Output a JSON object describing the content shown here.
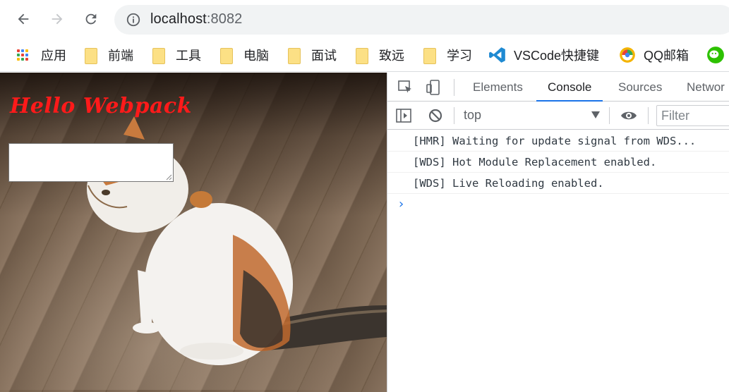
{
  "browser": {
    "url_host": "localhost",
    "url_port": ":8082"
  },
  "bookmarks": [
    {
      "label": "应用",
      "icon": "apps-icon"
    },
    {
      "label": "前端",
      "icon": "folder-icon"
    },
    {
      "label": "工具",
      "icon": "folder-icon"
    },
    {
      "label": "电脑",
      "icon": "folder-icon"
    },
    {
      "label": "面试",
      "icon": "folder-icon"
    },
    {
      "label": "致远",
      "icon": "folder-icon"
    },
    {
      "label": "学习",
      "icon": "folder-icon"
    },
    {
      "label": "VSCode快捷键",
      "icon": "vscode-icon"
    },
    {
      "label": "QQ邮箱",
      "icon": "qqmail-icon"
    }
  ],
  "page": {
    "heading": "Hello Webpack",
    "heading_color": "#ff1a1a"
  },
  "devtools": {
    "tabs": [
      "Elements",
      "Console",
      "Sources",
      "Networ"
    ],
    "active_tab": "Console",
    "context": "top",
    "filter_placeholder": "Filter",
    "logs": [
      "[HMR] Waiting for update signal from WDS...",
      "[WDS] Hot Module Replacement enabled.",
      "[WDS] Live Reloading enabled."
    ],
    "prompt": "›"
  }
}
